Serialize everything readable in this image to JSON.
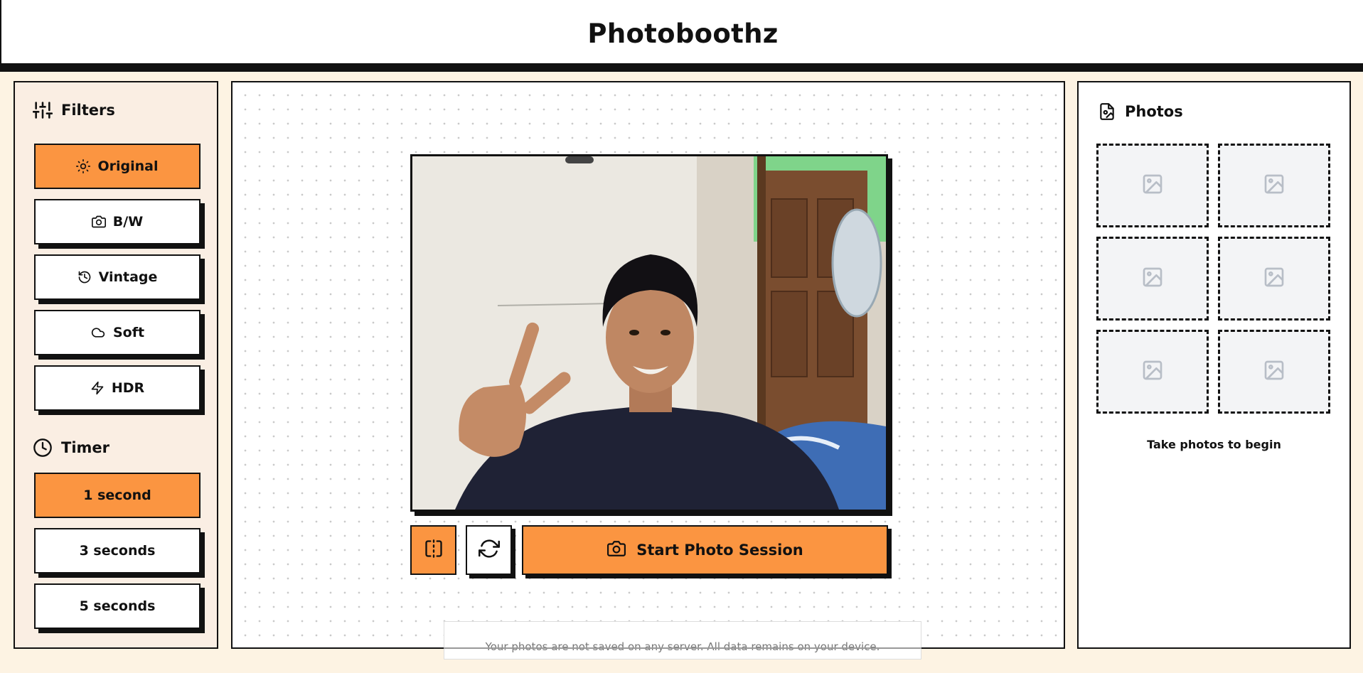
{
  "app": {
    "title": "Photoboothz"
  },
  "filters": {
    "heading": "Filters",
    "icon": "sliders-icon",
    "options": [
      {
        "label": "Original",
        "icon": "sun-icon",
        "active": true
      },
      {
        "label": "B/W",
        "icon": "camera-icon",
        "active": false
      },
      {
        "label": "Vintage",
        "icon": "history-icon",
        "active": false
      },
      {
        "label": "Soft",
        "icon": "cloud-icon",
        "active": false
      },
      {
        "label": "HDR",
        "icon": "zap-icon",
        "active": false
      }
    ]
  },
  "timer": {
    "heading": "Timer",
    "icon": "clock-icon",
    "options": [
      {
        "label": "1 second",
        "active": true
      },
      {
        "label": "3 seconds",
        "active": false
      },
      {
        "label": "5 seconds",
        "active": false
      }
    ]
  },
  "camera": {
    "mirror_icon": "flip-horizontal-icon",
    "switch_icon": "refresh-icon",
    "start_label": "Start Photo Session",
    "start_icon": "camera-icon"
  },
  "notice": "Your photos are not saved on any server. All data remains on your device.",
  "photos": {
    "heading": "Photos",
    "icon": "file-image-icon",
    "slot_icon": "image-placeholder-icon",
    "slot_count": 6,
    "empty_text": "Take photos to begin"
  },
  "colors": {
    "accent": "#fb9541",
    "page_background": "#fdf3e3",
    "sidebar_background": "#faeee3",
    "border": "#111111"
  }
}
